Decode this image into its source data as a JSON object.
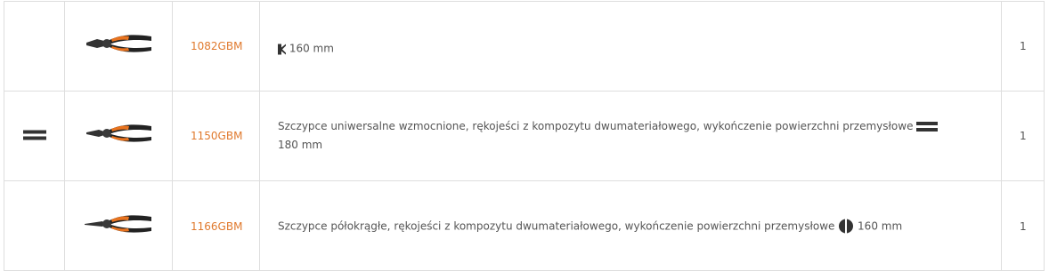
{
  "colors": {
    "code": "#e07a2e",
    "text": "#555555",
    "border": "#dedede",
    "handle_orange": "#e8731f",
    "handle_black": "#222222"
  },
  "rows": [
    {
      "mark_icon": "",
      "image_icon": "diagonal-cutter-pliers-icon",
      "code": "1082GBM",
      "desc_icon": "diagonal-cut-icon",
      "desc_text": "",
      "desc_size": "160 mm",
      "qty": "1"
    },
    {
      "mark_icon": "flat-jaw-icon",
      "image_icon": "combination-pliers-icon",
      "code": "1150GBM",
      "desc_text": "Szczypce uniwersalne wzmocnione, rękojeści z kompozytu dwumateriałowego, wykończenie powierzchni przemysłowe",
      "desc_icon": "flat-jaw-icon",
      "desc_size": "180 mm",
      "qty": "1"
    },
    {
      "mark_icon": "",
      "image_icon": "half-round-nose-pliers-icon",
      "code": "1166GBM",
      "desc_text": "Szczypce półokrągłe, rękojeści z kompozytu dwumateriałowego, wykończenie powierzchni przemysłowe",
      "desc_icon": "half-round-icon",
      "desc_size": "160 mm",
      "qty": "1"
    }
  ]
}
